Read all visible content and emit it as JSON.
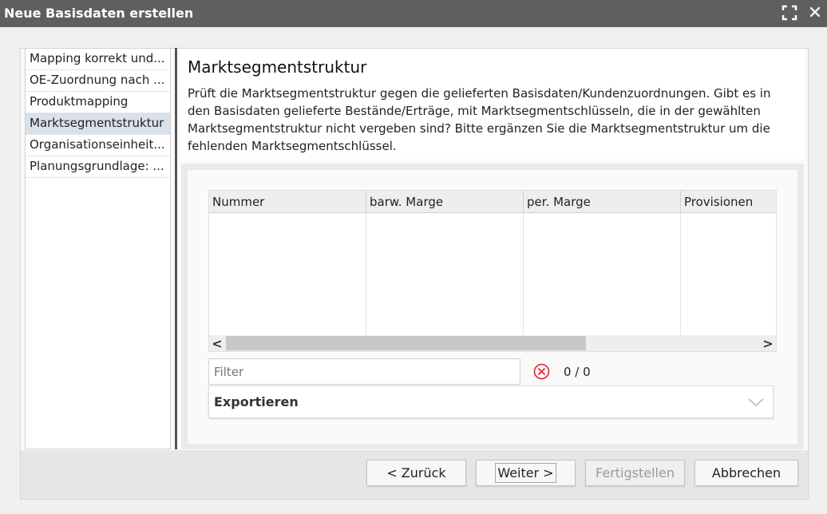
{
  "window": {
    "title": "Neue Basisdaten erstellen",
    "maximize_icon": "maximize-icon",
    "close_icon": "close-icon",
    "close_glyph": "✕"
  },
  "nav": {
    "items": [
      {
        "label": "Mapping korrekt und..."
      },
      {
        "label": "OE-Zuordnung nach ..."
      },
      {
        "label": "Produktmapping"
      },
      {
        "label": "Marktsegmentstruktur"
      },
      {
        "label": "Organisationseinheit..."
      },
      {
        "label": "Planungsgrundlage: ..."
      }
    ],
    "selected_index": 3
  },
  "description": {
    "title": "Marktsegmentstruktur",
    "text": "Prüft die Marktsegmentstruktur gegen die gelieferten Basisdaten/Kundenzuordnungen. Gibt es in den Basisdaten gelieferte Bestände/Erträge, mit Marktsegmentschlüsseln, die in der gewählten Marktsegmentstruktur nicht vergeben sind? Bitte ergänzen Sie die Marktsegmentstruktur um die fehlenden Marktsegmentschlüssel."
  },
  "table": {
    "columns": [
      "Nummer",
      "barw. Marge",
      "per. Marge",
      "Provisionen"
    ],
    "rows": [],
    "scroll_left_glyph": "<",
    "scroll_right_glyph": ">"
  },
  "filter": {
    "placeholder": "Filter",
    "value": "",
    "count": "0 / 0"
  },
  "export": {
    "label": "Exportieren"
  },
  "buttons": {
    "back": "< Zurück",
    "next": "Weiter >",
    "finish": "Fertigstellen",
    "cancel": "Abbrechen"
  },
  "colors": {
    "titlebar": "#5f5f5f",
    "nav_selected": "#d9e1ea",
    "clear_icon": "#e0242b"
  }
}
